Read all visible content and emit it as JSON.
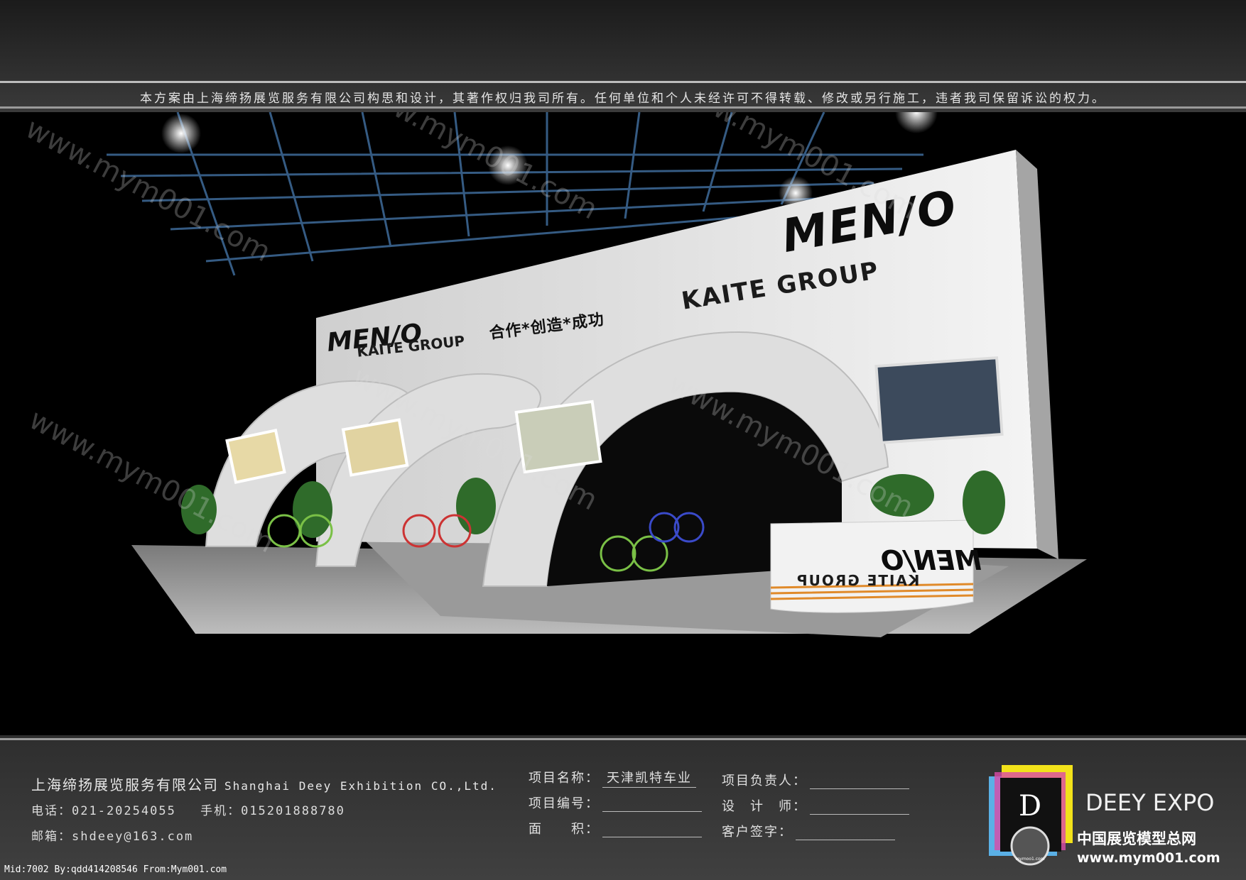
{
  "header": {
    "copyright": "本方案由上海缔扬展览服务有限公司构思和设计，其著作权归我司所有。任何单位和个人未经许可不得转载、修改或另行施工，违者我司保留诉讼的权力。"
  },
  "scene": {
    "brand_logo": "MEN/O",
    "group_name": "KAITE GROUP",
    "slogan": "合作*创造*成功",
    "watermark": "www.mym001.com"
  },
  "footer": {
    "company_cn": "上海缔扬展览服务有限公司",
    "company_en": "Shanghai Deey Exhibition CO.,Ltd.",
    "phone": "电话：021-20254055",
    "mobile": "手机：015201888780",
    "email": "邮箱：shdeey@163.com",
    "project_name_label": "项目名称：",
    "project_name_value": "天津凯特车业",
    "project_no_label": "项目编号：",
    "area_label": "面　　积：",
    "manager_label": "项目负责人：",
    "designer_label": "设　计　师：",
    "client_sign_label": "客户签字：",
    "brand_en": "DEEY EXPO",
    "brand_cn": "中国展览模型总网",
    "brand_url": "www.mym001.com",
    "logo_letter": "D",
    "logo_sub": "mymoo1.com"
  },
  "meta_line": "Mid:7002 By:qdd414208546 From:Mym001.com",
  "colors": {
    "accent_blue": "#2a6fd6",
    "stripe_orange": "#e08a2a",
    "wall_white": "#e9e9e9"
  }
}
